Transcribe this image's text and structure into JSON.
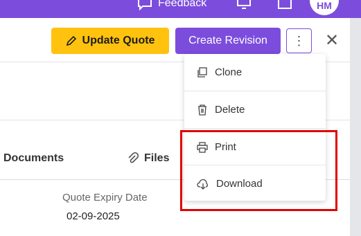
{
  "topbar": {
    "feedback_label": "Feedback",
    "avatar_initials": "HM",
    "color": "#7c4ddc"
  },
  "header": {
    "update_quote_label": "Update Quote",
    "create_revision_label": "Create Revision",
    "more_label": "⋮",
    "close_label": "✕",
    "colors": {
      "update": "#ffc20e",
      "revision": "#7c4ddc"
    }
  },
  "tabs": {
    "documents_label": "Documents",
    "files_label": "Files"
  },
  "details": {
    "quote_expiry_label": "Quote Expiry Date",
    "quote_expiry_value": "02-09-2025"
  },
  "menu": {
    "items": [
      {
        "label": "Clone",
        "icon": "copy-icon"
      },
      {
        "label": "Delete",
        "icon": "trash-icon"
      },
      {
        "label": "Print",
        "icon": "printer-icon"
      },
      {
        "label": "Download",
        "icon": "cloud-download-icon"
      }
    ]
  }
}
